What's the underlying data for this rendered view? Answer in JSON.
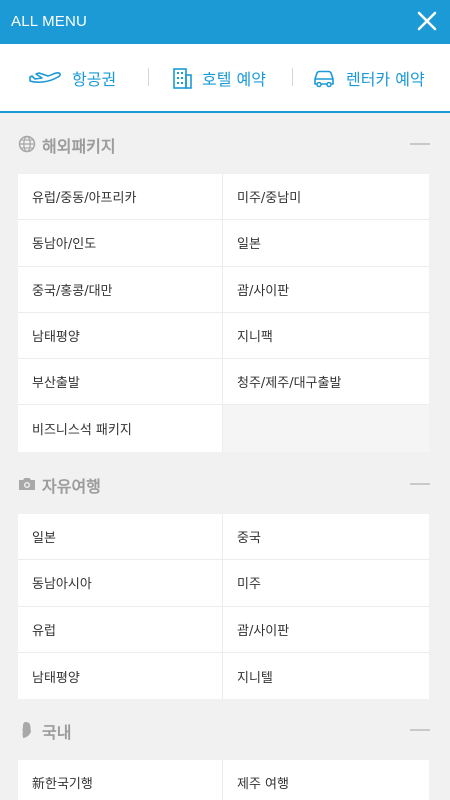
{
  "header": {
    "title": "ALL MENU",
    "close_icon": "close-icon"
  },
  "quick_links": [
    {
      "label": "항공권",
      "icon": "airplane-icon"
    },
    {
      "label": "호텔 예약",
      "icon": "hotel-building-icon"
    },
    {
      "label": "렌터카 예약",
      "icon": "car-icon"
    }
  ],
  "sections": [
    {
      "title": "해외패키지",
      "icon": "globe-icon",
      "items": [
        "유럽/중동/아프리카",
        "미주/중남미",
        "동남아/인도",
        "일본",
        "중국/홍콩/대만",
        "괌/사이판",
        "남태평양",
        "지니팩",
        "부산출발",
        "청주/제주/대구출발",
        "비즈니스석 패키지",
        ""
      ]
    },
    {
      "title": "자유여행",
      "icon": "camera-icon",
      "items": [
        "일본",
        "중국",
        "동남아시아",
        "미주",
        "유럽",
        "괌/사이판",
        "남태평양",
        "지니텔"
      ]
    },
    {
      "title": "국내",
      "icon": "korea-map-icon",
      "items": [
        "新한국기행",
        "제주 여행"
      ]
    }
  ],
  "colors": {
    "accent": "#1b9ad6",
    "section_text": "#9c9c9c",
    "background": "#f1f1f1"
  }
}
